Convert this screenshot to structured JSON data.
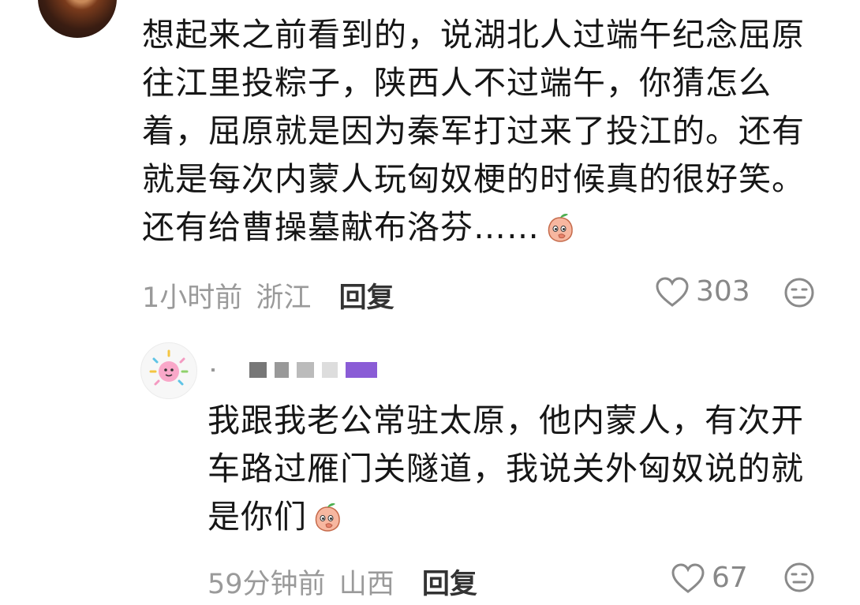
{
  "comment": {
    "text": "想起来之前看到的，说湖北人过端午纪念屈原往江里投粽子，陕西人不过端午，你猜怎么着，屈原就是因为秦军打过来了投江的。还有就是每次内蒙人玩匈奴梗的时候真的很好笑。还有给曹操墓献布洛芬……",
    "emoji_icon": "peach-emoji-icon",
    "time": "1小时前",
    "location": "浙江",
    "reply_label": "回复",
    "likes": "303"
  },
  "reply": {
    "text": "我跟我老公常驻太原，他内蒙人，有次开车路过雁门关隧道，我说关外匈奴说的就是你们",
    "emoji_icon": "peach-emoji-icon",
    "time": "59分钟前",
    "location": "山西",
    "reply_label": "回复",
    "likes": "67"
  },
  "colors": {
    "text": "#161616",
    "meta": "#9a9a9a",
    "icon": "#888888",
    "name_accent": "#8a5cd6"
  }
}
